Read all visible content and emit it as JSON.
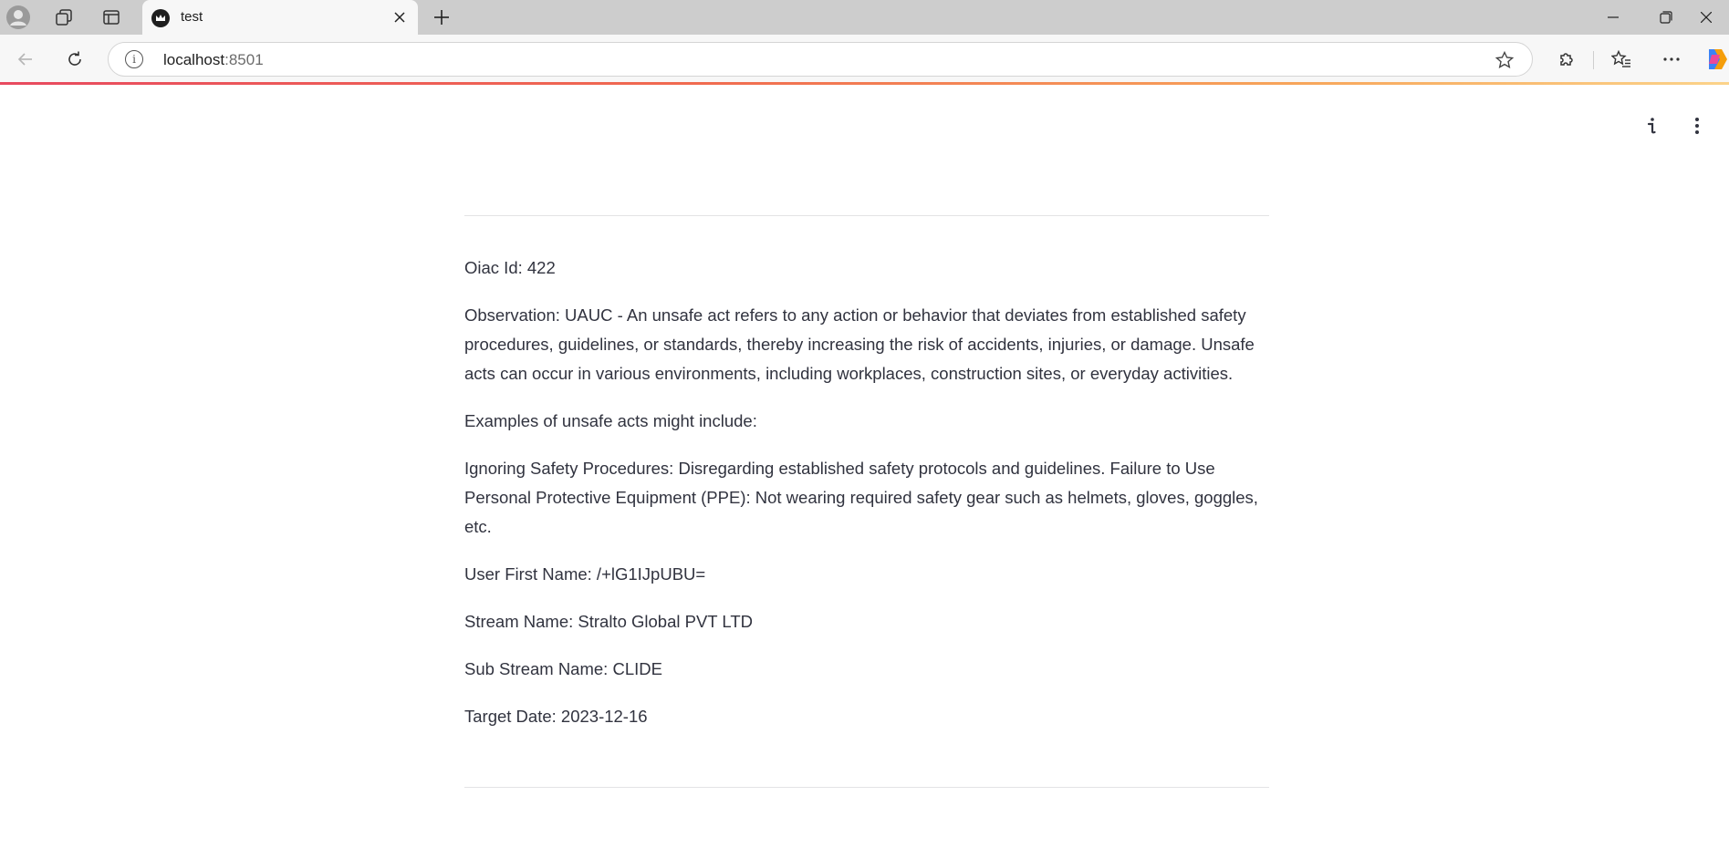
{
  "browser": {
    "tab": {
      "title": "test"
    },
    "address": {
      "host": "localhost",
      "port": ":8501"
    }
  },
  "app": {
    "fields": {
      "oiac_id": "Oiac Id: 422",
      "observation": "Observation: UAUC - An unsafe act refers to any action or behavior that deviates from established safety procedures, guidelines, or standards, thereby increasing the risk of accidents, injuries, or damage. Unsafe acts can occur in various environments, including workplaces, construction sites, or everyday activities.",
      "examples_heading": "Examples of unsafe acts might include:",
      "examples_body": "Ignoring Safety Procedures: Disregarding established safety protocols and guidelines. Failure to Use Personal Protective Equipment (PPE): Not wearing required safety gear such as helmets, gloves, goggles, etc.",
      "user_first_name": "User First Name: /+lG1IJpUBU=",
      "stream_name": "Stream Name: Stralto Global PVT LTD",
      "sub_stream_name": "Sub Stream Name: CLIDE",
      "target_date": "Target Date: 2023-12-16"
    }
  }
}
